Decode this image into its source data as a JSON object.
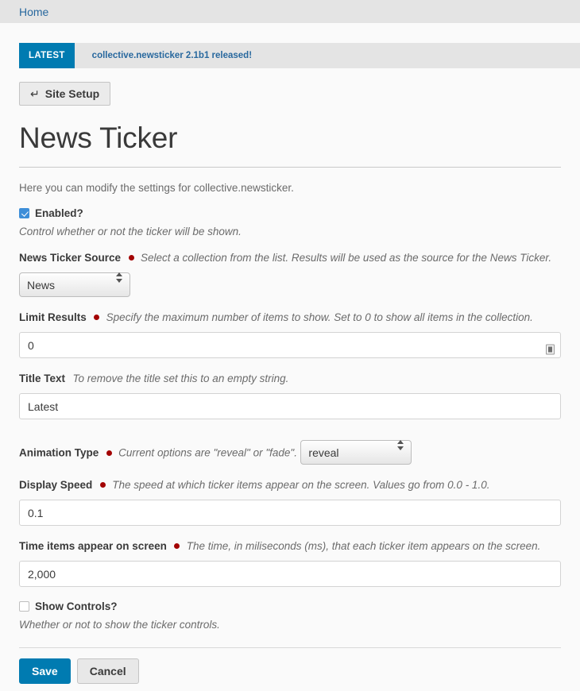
{
  "breadcrumb": {
    "home_label": "Home"
  },
  "ticker": {
    "badge_label": "LATEST",
    "message": "collective.newsticker 2.1b1 released!",
    "badge_color": "#007bb1",
    "bar_color": "#e4e4e4"
  },
  "toolbar": {
    "site_setup_label": "Site Setup",
    "site_setup_icon": "return-arrow-icon",
    "site_setup_glyph": "↵"
  },
  "page": {
    "title": "News Ticker",
    "description": "Here you can modify the settings for collective.newsticker."
  },
  "fields": {
    "enabled": {
      "label": "Enabled?",
      "checked": true,
      "hint": "Control whether or not the ticker will be shown."
    },
    "source": {
      "label": "News Ticker Source",
      "required": true,
      "hint": "Select a collection from the list. Results will be used as the source for the News Ticker.",
      "value": "News",
      "options": [
        "News"
      ]
    },
    "limit_results": {
      "label": "Limit Results",
      "required": true,
      "hint": "Specify the maximum number of items to show. Set to 0 to show all items in the collection.",
      "value": "0"
    },
    "title_text": {
      "label": "Title Text",
      "required": false,
      "hint": "To remove the title set this to an empty string.",
      "value": "Latest"
    },
    "animation_type": {
      "label": "Animation Type",
      "required": true,
      "hint": "Current options are \"reveal\" or \"fade\".",
      "value": "reveal",
      "options": [
        "reveal",
        "fade"
      ]
    },
    "display_speed": {
      "label": "Display Speed",
      "required": true,
      "hint": "The speed at which ticker items appear on the screen. Values go from 0.0 - 1.0.",
      "value": "0.1"
    },
    "time_on_screen": {
      "label": "Time items appear on screen",
      "required": true,
      "hint": "The time, in miliseconds (ms), that each ticker item appears on the screen.",
      "value": "2,000"
    },
    "show_controls": {
      "label": "Show Controls?",
      "checked": false,
      "hint": "Whether or not to show the ticker controls."
    }
  },
  "actions": {
    "save_label": "Save",
    "cancel_label": "Cancel",
    "primary_color": "#007bb1"
  }
}
